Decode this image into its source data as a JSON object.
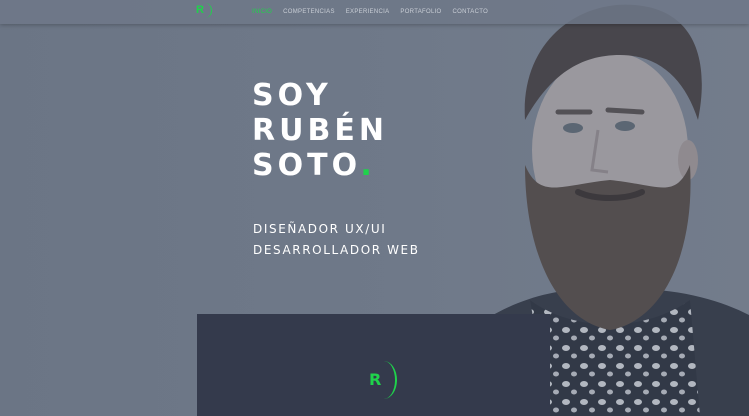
{
  "brand": {
    "logo_letter": "R",
    "accent": "#1fd24b"
  },
  "nav": {
    "items": [
      {
        "label": "INICIO",
        "active": true
      },
      {
        "label": "COMPETENCIAS",
        "active": false
      },
      {
        "label": "EXPERIENCIA",
        "active": false
      },
      {
        "label": "PORTAFOLIO",
        "active": false
      },
      {
        "label": "CONTACTO",
        "active": false
      }
    ]
  },
  "hero": {
    "line1": "SOY",
    "line2": "RUBÉN",
    "line3": "SOTO",
    "dot": ".",
    "role1": "DISEÑADOR UX/UI",
    "role2": "DESARROLLADOR WEB"
  },
  "card": {
    "logo_letter": "R"
  }
}
